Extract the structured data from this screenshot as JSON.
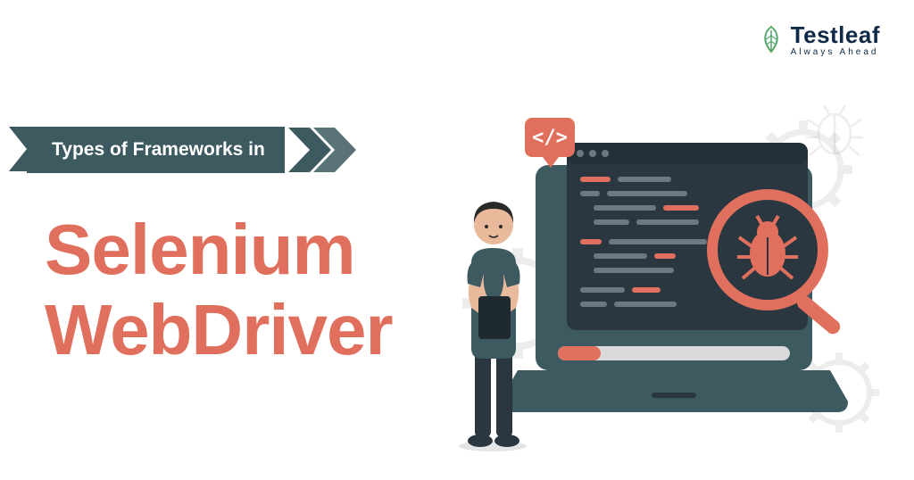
{
  "logo": {
    "brand": "Testleaf",
    "tagline": "Always Ahead"
  },
  "ribbon": {
    "label": "Types of Frameworks in"
  },
  "title": {
    "line1": "Selenium",
    "line2": "WebDriver"
  },
  "colors": {
    "accent": "#e0705d",
    "dark": "#3c5a60",
    "darkBlue": "#0e2a47",
    "screen": "#2a3740",
    "leaf": "#58a86d"
  },
  "illustration": {
    "codeTag": "</>",
    "bugIcon": "bug-icon",
    "gearIcon": "gear-icon",
    "laptop": "laptop-icon",
    "person": "person-icon",
    "magnifier": "magnifier-icon"
  }
}
